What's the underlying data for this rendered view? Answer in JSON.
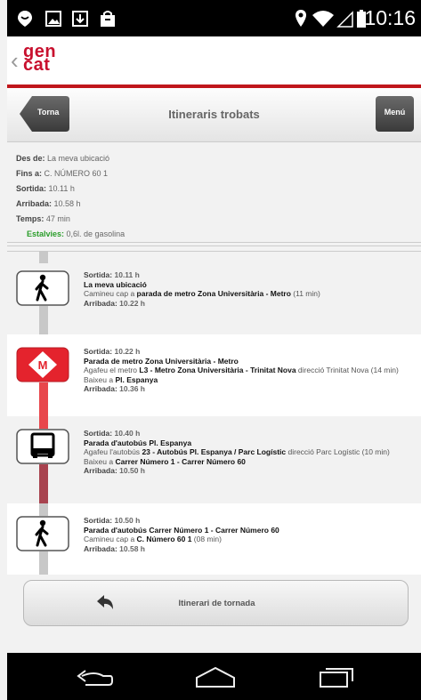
{
  "status_bar": {
    "time": "10:16"
  },
  "header": {
    "logo_line1": "gen",
    "logo_line2": "cat"
  },
  "toolbar": {
    "back_label": "Torna",
    "title": "Itineraris trobats",
    "menu_label": "Menú"
  },
  "summary": [
    {
      "key": "Des de:",
      "value": " La meva ubicació"
    },
    {
      "key": "Fins a:",
      "value": " C. NÚMERO 60 1"
    },
    {
      "key": "Sortida:",
      "value": " 10.11 h"
    },
    {
      "key": "Arribada:",
      "value": " 10.58 h"
    },
    {
      "key": "Temps:",
      "value": " 47 min"
    }
  ],
  "savings": {
    "key": "Estalvies:",
    "value": " 0,6l. de gasolina"
  },
  "legs": [
    {
      "icon": "walk-icon",
      "departure_key": "Sortida:",
      "departure_time": " 10.11 h",
      "place": "La meva ubicació",
      "instr_prefix": "Camineu cap a ",
      "instr_bold": "parada de metro Zona Universitària - Metro",
      "instr_suffix": " (11 min)",
      "alight_prefix": "",
      "alight_bold": "",
      "arrival_key": "Arribada:",
      "arrival_time": " 10.22 h",
      "stem_color": "#c8c8c8"
    },
    {
      "icon": "metro-icon",
      "departure_key": "Sortida:",
      "departure_time": " 10.22 h",
      "place": "Parada de metro Zona Universitària - Metro",
      "instr_prefix": "Agafeu el metro ",
      "instr_bold": "L3 - Metro Zona Universitària - Trinitat Nova",
      "instr_suffix": " direcció Trinitat Nova (14 min)",
      "alight_prefix": "Baixeu a ",
      "alight_bold": "Pl. Espanya",
      "arrival_key": "Arribada:",
      "arrival_time": " 10.36 h",
      "stem_color": "#e8474c"
    },
    {
      "icon": "bus-icon",
      "departure_key": "Sortida:",
      "departure_time": " 10.40 h",
      "place": "Parada d'autobús Pl. Espanya",
      "instr_prefix": "Agafeu l'autobús ",
      "instr_bold": "23 - Autobús Pl. Espanya / Parc Logístic",
      "instr_suffix": " direcció Parc Logístic (10 min)",
      "alight_prefix": "Baixeu a ",
      "alight_bold": "Carrer Número 1 - Carrer Número 60",
      "arrival_key": "Arribada:",
      "arrival_time": " 10.50 h",
      "stem_color": "#a8434f"
    },
    {
      "icon": "walk-icon",
      "departure_key": "Sortida:",
      "departure_time": " 10.50 h",
      "place": "Parada d'autobús Carrer Número 1 - Carrer Número 60",
      "instr_prefix": "Camineu cap a ",
      "instr_bold": "C. Número 60 1",
      "instr_suffix": " (08 min)",
      "alight_prefix": "",
      "alight_bold": "",
      "arrival_key": "Arribada:",
      "arrival_time": " 10.58 h",
      "stem_color": "#c8c8c8"
    }
  ],
  "return_button": {
    "label": "Itinerari de tornada"
  },
  "colors": {
    "accent_red": "#c0161b",
    "savings_green": "#2a9d2a"
  }
}
